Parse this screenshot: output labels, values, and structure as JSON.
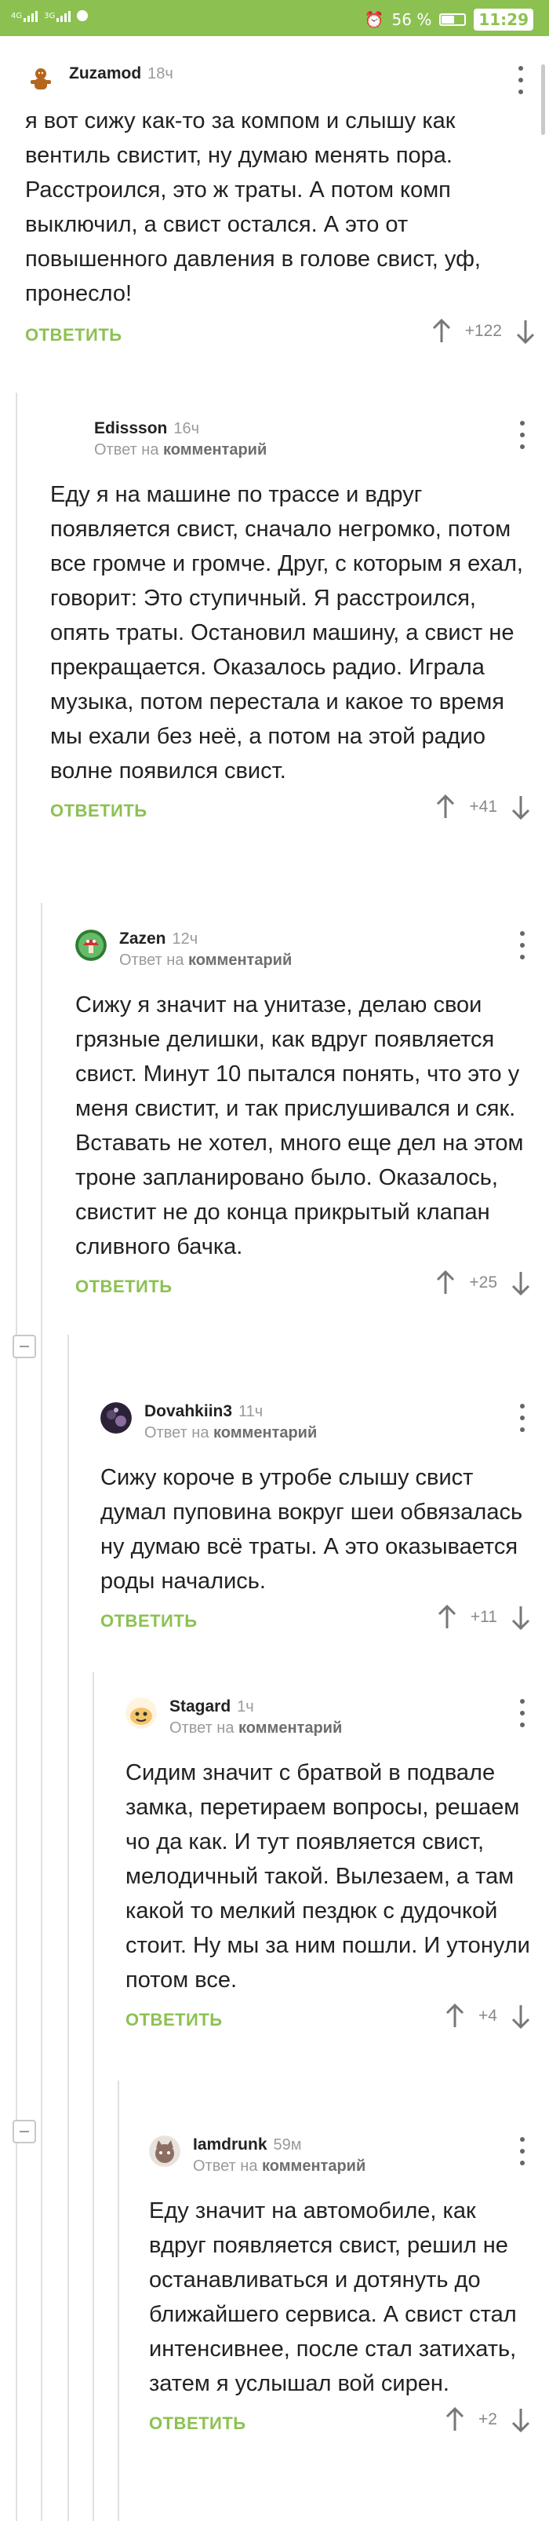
{
  "status_bar": {
    "network_1": "4G",
    "network_2": "3G",
    "battery": "56 %",
    "time": "11:29",
    "brand_color": "#8cc152"
  },
  "reply_to_text": "Ответ на",
  "reply_to_target": "комментарий",
  "reply_label": "ОТВЕТИТЬ",
  "comments": [
    {
      "user": "Zuzamod",
      "time": "18ч",
      "text": "я вот сижу как-то за компом и слышу как вентиль свистит, ну думаю менять пора. Расстроился, это ж траты. А потом комп выключил, а свист остался. А это от повышенного давления в голове свист, уф, пронесло!",
      "rating": "+122",
      "avatar_icon": "gingerbread-avatar-icon"
    },
    {
      "user": "Edissson",
      "time": "16ч",
      "text": "Еду я на машине по трассе и вдруг появляется свист, сначало негромко, потом все громче и громче. Друг, с которым я ехал, говорит: Это ступичный. Я расстроился, опять траты. Остановил машину, а свист не прекращается. Оказалось радио. Играла музыка, потом перестала и какое то время мы ехали без неё, а потом на этой радио волне появился свист.",
      "rating": "+41",
      "avatar_icon": "blank-avatar-icon"
    },
    {
      "user": "Zazen",
      "time": "12ч",
      "text": "Сижу я значит на унитазе, делаю свои грязные делишки, как вдруг появляется свист. Минут 10 пытался понять, что это у меня свистит, и так прислушивался и сяк. Вставать не хотел, много еще дел на этом троне запланировано было. Оказалось, свистит не до конца прикрытый клапан сливного бачка.",
      "rating": "+25",
      "avatar_icon": "mushroom-avatar-icon"
    },
    {
      "user": "Dovahkiin3",
      "time": "11ч",
      "text": "Сижу короче в утробе слышу свист думал пуповина вокруг шеи обвязалась ну думаю всё траты. А это оказывается роды начались.",
      "rating": "+11",
      "avatar_icon": "dark-photo-avatar-icon"
    },
    {
      "user": "Stagard",
      "time": "1ч",
      "text": "Сидим значит с братвой в подвале замка, перетираем вопросы, решаем чо да как. И тут появляется свист, мелодичный такой. Вылезаем, а там какой то мелкий пездюк с дудочкой стоит. Ну мы за ним пошли. И утонули потом все.",
      "rating": "+4",
      "avatar_icon": "cartoon-avatar-icon"
    },
    {
      "user": "Iamdrunk",
      "time": "59м",
      "text": "Еду значит на автомобиле, как вдруг появляется свист, решил не останавливаться и дотянуть до ближайшего сервиса. А свист стал интенсивнее, после стал затихать, затем я услышал вой сирен.",
      "rating": "+2",
      "avatar_icon": "cat-avatar-icon"
    }
  ]
}
